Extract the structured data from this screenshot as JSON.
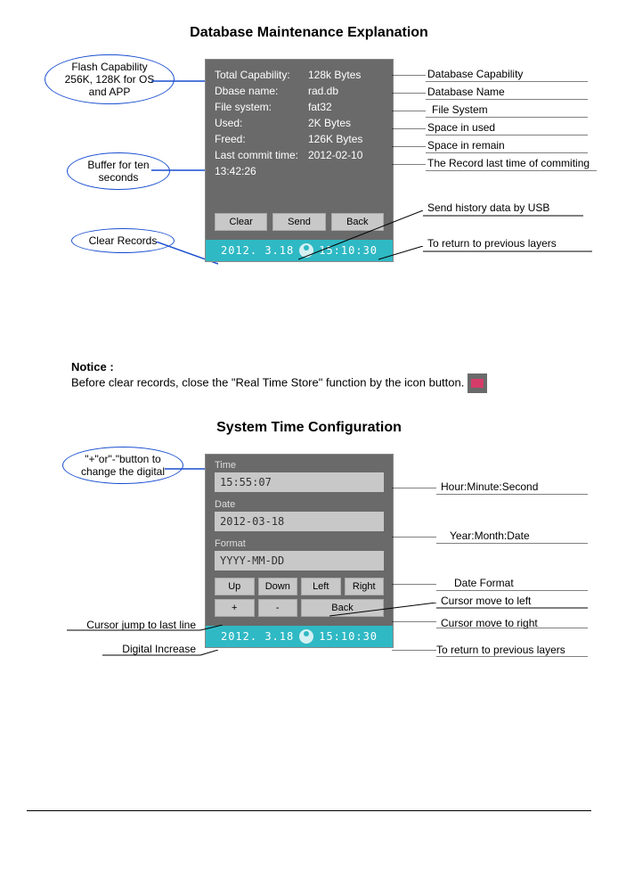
{
  "section1": {
    "title": "Database Maintenance Explanation",
    "callouts": {
      "flash": "Flash Capability 256K, 128K  for OS and APP",
      "buffer": "Buffer for ten seconds",
      "clear": "Clear Records"
    },
    "info": {
      "total_label": "Total Capability:",
      "total_value": "128k Bytes",
      "dbname_label": "Dbase name:",
      "dbname_value": "rad.db",
      "fs_label": "File system:",
      "fs_value": "fat32",
      "used_label": "Used:",
      "used_value": "2K Bytes",
      "freed_label": "Freed:",
      "freed_value": "126K Bytes",
      "last_label": "Last commit time:",
      "last_value": "2012-02-10",
      "last_time": "13:42:26"
    },
    "buttons": {
      "clear": "Clear",
      "send": "Send",
      "back": "Back"
    },
    "status": {
      "date": "2012. 3.18",
      "time": "15:10:30"
    },
    "annotations": {
      "cap": "Database Capability",
      "name": "Database Name",
      "fs": "File System",
      "used": "Space in used",
      "remain": "Space in remain",
      "last": "The Record last time of commiting",
      "send": "Send history data by USB",
      "back": "To return to previous layers"
    }
  },
  "notice": {
    "title": "Notice :",
    "text": "Before clear records, close the \"Real Time Store\" function  by the icon button."
  },
  "section2": {
    "title": "System Time Configuration",
    "callouts": {
      "pm": "\"+\"or\"-\"button to change the digital"
    },
    "fields": {
      "time_label": "Time",
      "time_value": "15:55:07",
      "date_label": "Date",
      "date_value": "2012-03-18",
      "format_label": "Format",
      "format_value": "YYYY-MM-DD"
    },
    "buttons": {
      "up": "Up",
      "down": "Down",
      "left": "Left",
      "right": "Right",
      "plus": "+",
      "minus": "-",
      "back": "Back"
    },
    "status": {
      "date": "2012. 3.18",
      "time": "15:10:30"
    },
    "annotations": {
      "time": "Hour:Minute:Second",
      "date": "Year:Month:Date",
      "format": "Date Format",
      "left": "Cursor move to left",
      "right": "Cursor move to right",
      "up": "Cursor jump to last line",
      "plus": "Digital Increase",
      "back": "To return to previous layers"
    }
  }
}
